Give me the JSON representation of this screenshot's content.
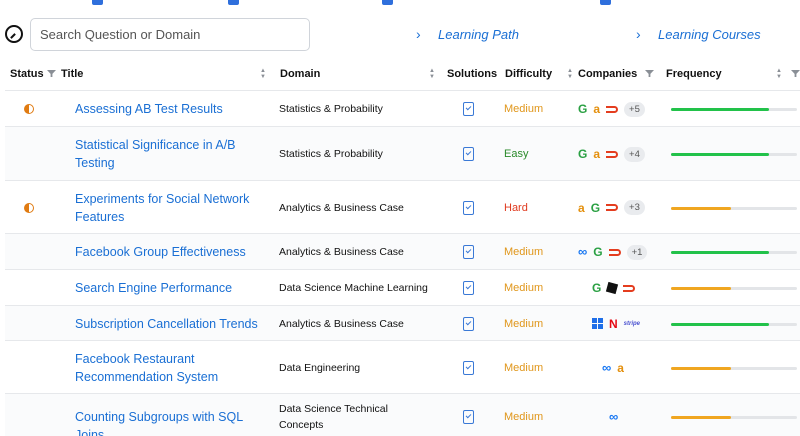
{
  "search": {
    "placeholder": "Search Question or Domain"
  },
  "nav": {
    "learning_path": "Learning Path",
    "learning_courses": "Learning Courses"
  },
  "columns": {
    "status": "Status",
    "title": "Title",
    "domain": "Domain",
    "solutions": "Solutions",
    "difficulty": "Difficulty",
    "companies": "Companies",
    "frequency": "Frequency"
  },
  "colors": {
    "link": "#1a6fd4",
    "medium": "#e0961a",
    "easy": "#2a8a2a",
    "hard": "#e03a1f",
    "freq_high": "#22c24a",
    "freq_mid": "#f0a620"
  },
  "rows": [
    {
      "status": "in-progress",
      "title": [
        "Assessing AB Test Results"
      ],
      "domain": [
        "Statistics & Probability"
      ],
      "difficulty": "Medium",
      "logos": [
        "google",
        "amazon",
        "doordash"
      ],
      "more": "+5",
      "frequency": 0.78
    },
    {
      "status": "none",
      "title": [
        "Statistical Significance in A/B",
        "Testing"
      ],
      "domain": [
        "Statistics & Probability"
      ],
      "difficulty": "Easy",
      "logos": [
        "google",
        "amazon",
        "doordash"
      ],
      "more": "+4",
      "frequency": 0.78
    },
    {
      "status": "in-progress",
      "title": [
        "Experiments for Social Network",
        "Features"
      ],
      "domain": [
        "Analytics & Business Case"
      ],
      "difficulty": "Hard",
      "logos": [
        "amazon",
        "google",
        "doordash"
      ],
      "more": "+3",
      "frequency": 0.48
    },
    {
      "status": "none",
      "title": [
        "Facebook Group Effectiveness"
      ],
      "domain": [
        "Analytics & Business Case"
      ],
      "difficulty": "Medium",
      "logos": [
        "meta",
        "google",
        "doordash"
      ],
      "more": "+1",
      "frequency": 0.78
    },
    {
      "status": "none",
      "title": [
        "Search Engine Performance"
      ],
      "domain": [
        "Data Science Machine Learning"
      ],
      "difficulty": "Medium",
      "logos": [
        "google",
        "roblox",
        "doordash"
      ],
      "more": "",
      "frequency": 0.48
    },
    {
      "status": "none",
      "title": [
        "Subscription Cancellation Trends"
      ],
      "domain": [
        "Analytics & Business Case"
      ],
      "difficulty": "Medium",
      "logos": [
        "microsoft",
        "netflix",
        "stripe"
      ],
      "more": "",
      "frequency": 0.78
    },
    {
      "status": "none",
      "title": [
        "Facebook Restaurant",
        "Recommendation System"
      ],
      "domain": [
        "Data Engineering"
      ],
      "difficulty": "Medium",
      "logos": [
        "meta",
        "amazon"
      ],
      "more": "",
      "frequency": 0.48
    },
    {
      "status": "none",
      "title": [
        "Counting Subgroups with SQL Joins"
      ],
      "domain": [
        "Data Science Technical",
        "Concepts"
      ],
      "difficulty": "Medium",
      "logos": [
        "meta"
      ],
      "more": "",
      "frequency": 0.48
    }
  ]
}
